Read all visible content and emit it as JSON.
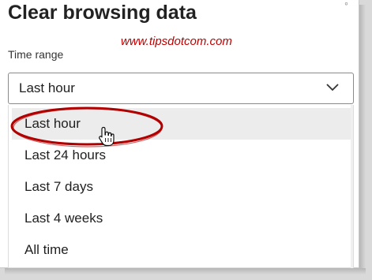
{
  "dialog": {
    "title": "Clear browsing data",
    "watermark": "www.tipsdotcom.com"
  },
  "time_range": {
    "label": "Time range",
    "selected": "Last hour",
    "options": [
      {
        "label": "Last hour",
        "highlighted": true
      },
      {
        "label": "Last 24 hours",
        "highlighted": false
      },
      {
        "label": "Last 7 days",
        "highlighted": false
      },
      {
        "label": "Last 4 weeks",
        "highlighted": false
      },
      {
        "label": "All time",
        "highlighted": false
      }
    ]
  },
  "colors": {
    "annotation_ellipse": "#b00000",
    "highlight_bg": "#ececec",
    "watermark_text": "#c00000"
  },
  "icons": {
    "select_chevron": "chevron-down-icon",
    "cursor": "hand-pointer-icon"
  }
}
